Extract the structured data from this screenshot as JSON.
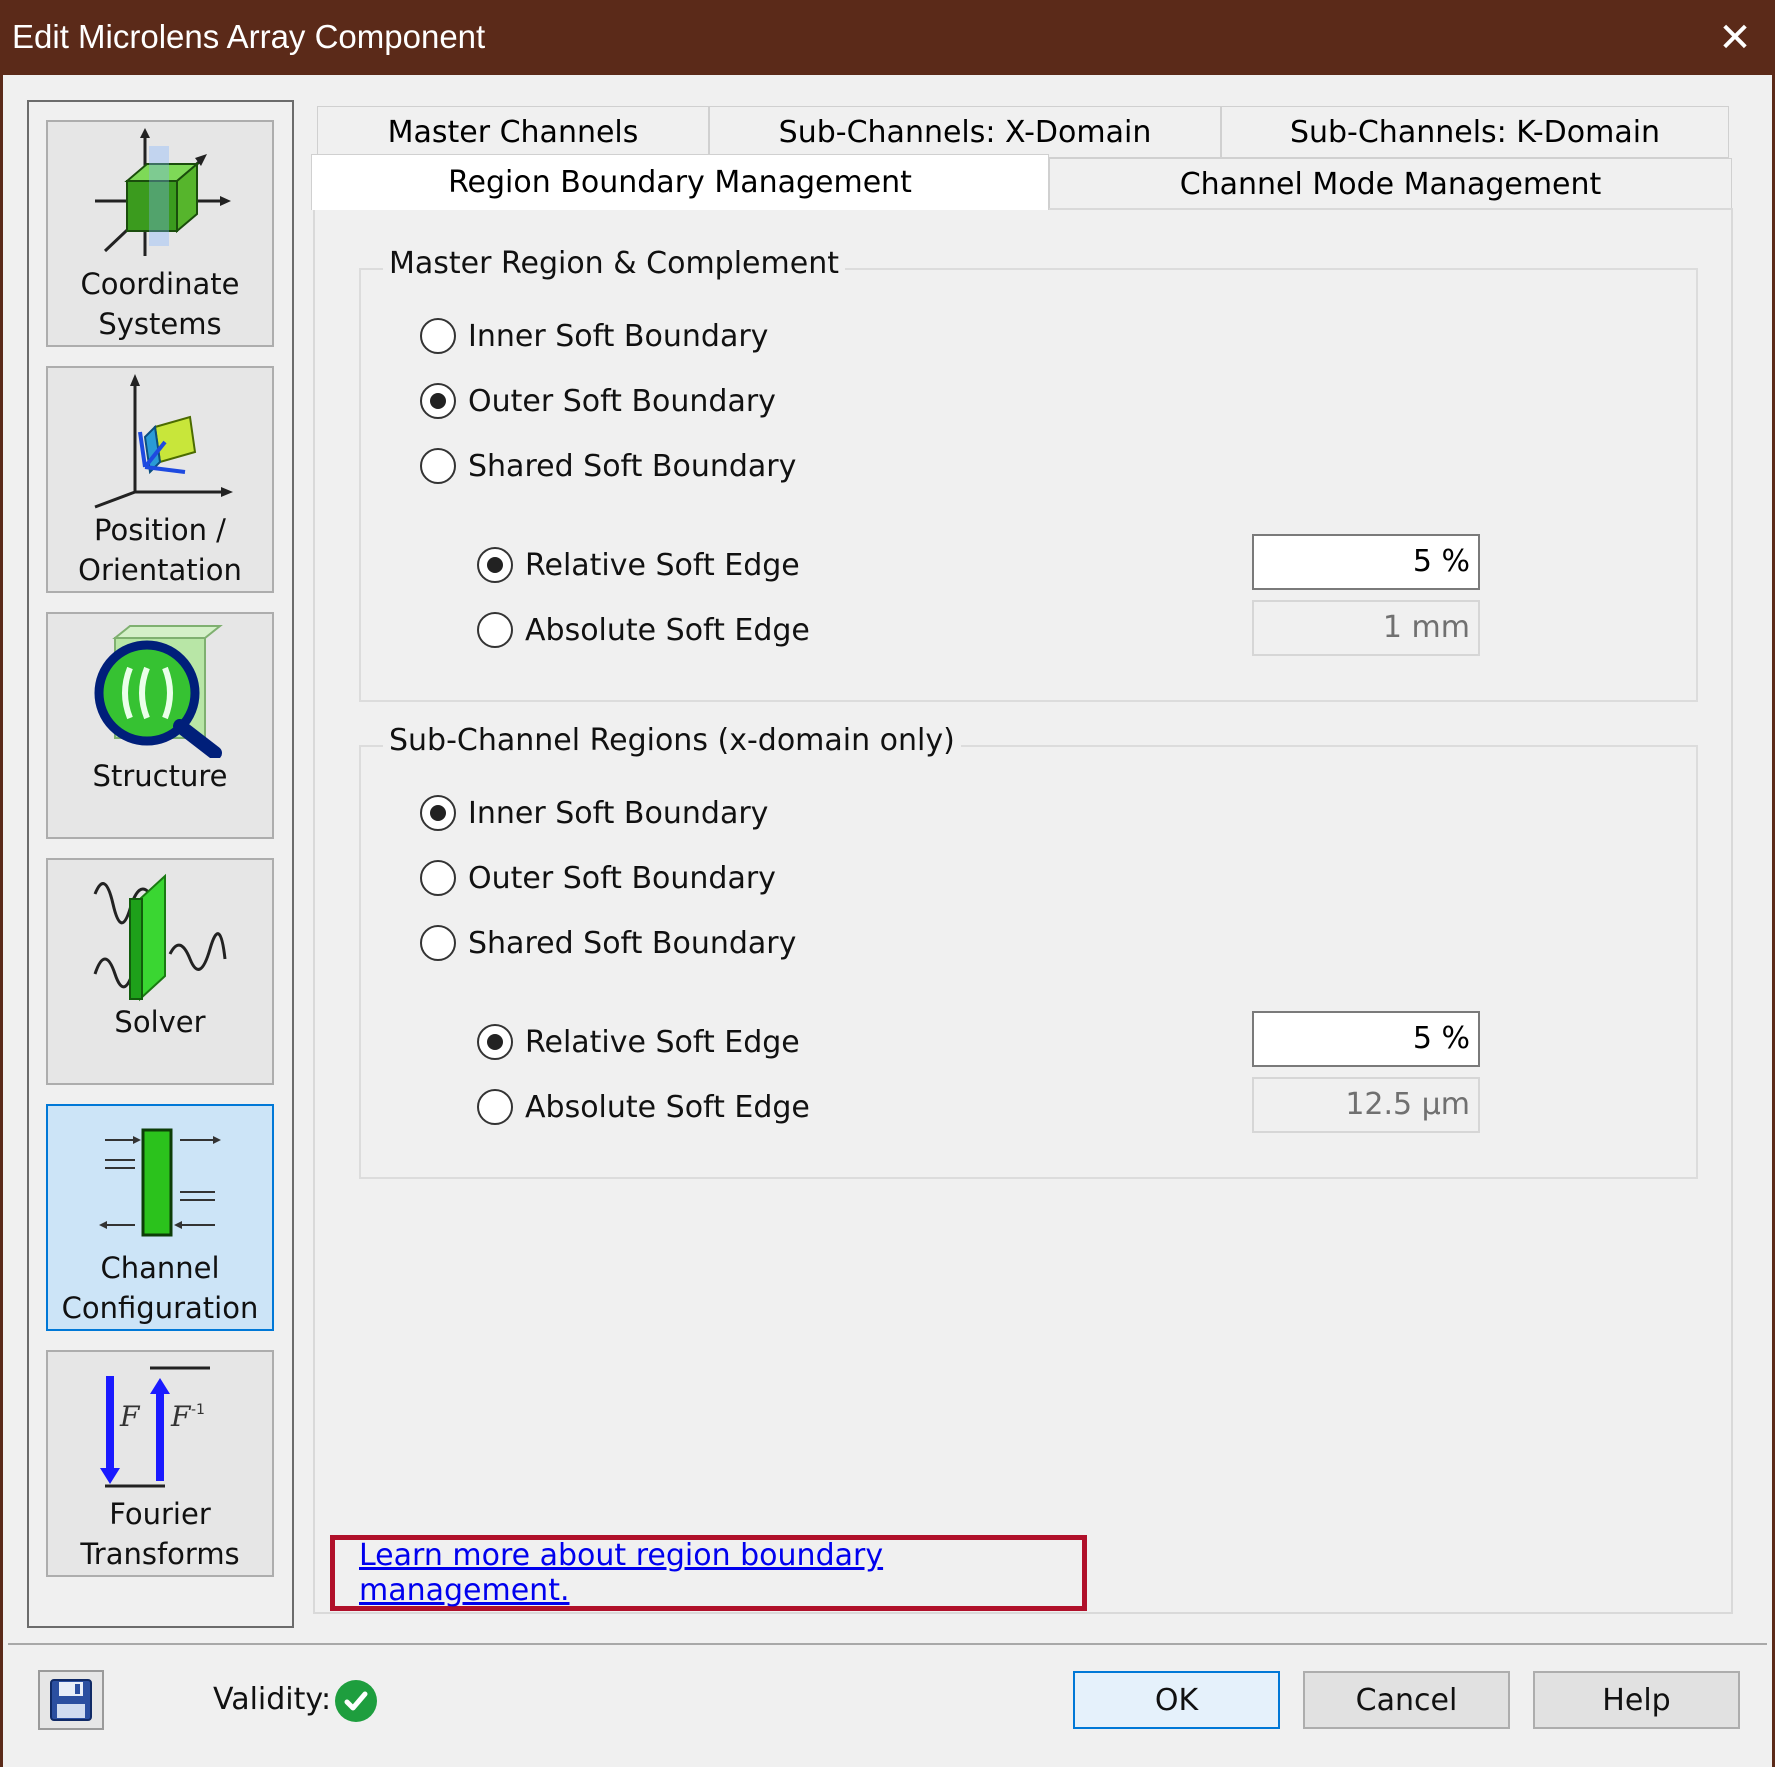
{
  "window": {
    "title": "Edit Microlens Array Component",
    "close_label": "✕"
  },
  "sidebar": {
    "items": [
      {
        "label": "Coordinate\nSystems",
        "icon": "coordinate-systems-icon"
      },
      {
        "label": "Position /\nOrientation",
        "icon": "position-orientation-icon"
      },
      {
        "label": "Structure",
        "icon": "structure-icon"
      },
      {
        "label": "Solver",
        "icon": "solver-icon"
      },
      {
        "label": "Channel\nConfiguration",
        "icon": "channel-configuration-icon",
        "active": true
      },
      {
        "label": "Fourier\nTransforms",
        "icon": "fourier-transforms-icon"
      }
    ]
  },
  "tabs": {
    "row1": [
      "Master Channels",
      "Sub-Channels: X-Domain",
      "Sub-Channels: K-Domain"
    ],
    "row2": [
      "Region Boundary Management",
      "Channel Mode Management"
    ],
    "active": "Region Boundary Management"
  },
  "master_group": {
    "title": "Master Region & Complement",
    "options": [
      "Inner Soft Boundary",
      "Outer Soft Boundary",
      "Shared Soft Boundary"
    ],
    "selected": "Outer Soft Boundary",
    "edge_options": [
      "Relative Soft Edge",
      "Absolute Soft Edge"
    ],
    "edge_selected": "Relative Soft Edge",
    "relative_value": "5 %",
    "absolute_value": "1 mm"
  },
  "sub_group": {
    "title": "Sub-Channel Regions (x-domain only)",
    "options": [
      "Inner Soft Boundary",
      "Outer Soft Boundary",
      "Shared Soft Boundary"
    ],
    "selected": "Inner Soft Boundary",
    "edge_options": [
      "Relative Soft Edge",
      "Absolute Soft Edge"
    ],
    "edge_selected": "Relative Soft Edge",
    "relative_value": "5 %",
    "absolute_value": "12.5 µm"
  },
  "learn_more_link": "Learn more about region boundary management.",
  "footer": {
    "validity_label": "Validity:",
    "ok": "OK",
    "cancel": "Cancel",
    "help": "Help"
  },
  "colors": {
    "titlebar": "#5b2a19",
    "highlight_box": "#b0102a",
    "active_sidebar": "#cce4f7",
    "link": "#0000ee",
    "valid": "#1e9e3e"
  }
}
